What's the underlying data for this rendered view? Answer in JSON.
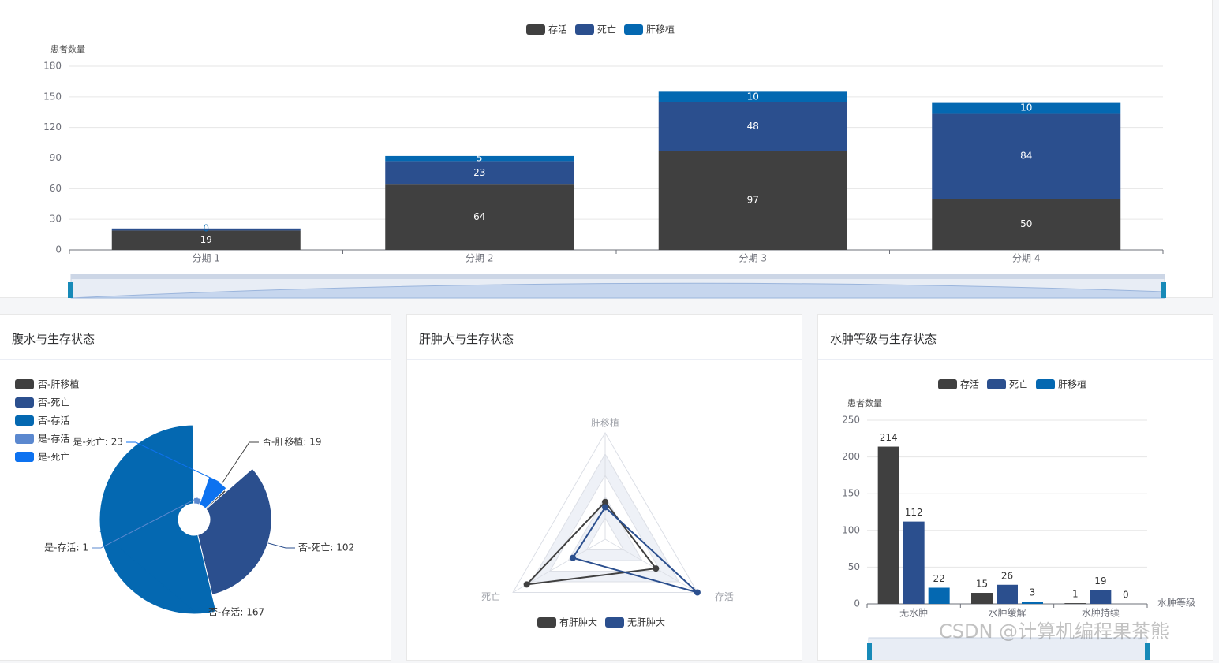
{
  "colors": {
    "survive": "#404040",
    "death": "#2b4f8e",
    "transplant": "#0468b1",
    "light_blue": "#5b88cf",
    "bright_blue": "#0d72f0",
    "grid": "#e6e6e6",
    "axis": "#6e7079"
  },
  "stage_chart": {
    "chart_data": {
      "type": "bar",
      "stacked": true,
      "title": "",
      "xlabel": "",
      "ylabel": "患者数量",
      "categories": [
        "分期 1",
        "分期 2",
        "分期 3",
        "分期 4"
      ],
      "yticks": [
        0,
        30,
        60,
        90,
        120,
        150,
        180
      ],
      "ylim": [
        0,
        180
      ],
      "legend_position": "top-center",
      "grid": true,
      "series": [
        {
          "name": "存活",
          "values": [
            19,
            64,
            97,
            50
          ]
        },
        {
          "name": "死亡",
          "values": [
            2,
            23,
            48,
            84
          ]
        },
        {
          "name": "肝移植",
          "values": [
            0,
            5,
            10,
            10
          ]
        }
      ],
      "data_labels": [
        [
          "19",
          "64",
          "97",
          "50"
        ],
        [
          "",
          "23",
          "48",
          "84"
        ],
        [
          "0",
          "5",
          "10",
          "10"
        ]
      ]
    }
  },
  "ascites_chart": {
    "title": "腹水与生存状态",
    "chart_data": {
      "type": "pie",
      "rose": true,
      "title": "",
      "legend_position": "top-left",
      "slices": [
        {
          "name": "否-肝移植",
          "value": 19,
          "label": "否-肝移植: 19"
        },
        {
          "name": "否-死亡",
          "value": 102,
          "label": "否-死亡: 102"
        },
        {
          "name": "否-存活",
          "value": 167,
          "label": "否-存活: 167"
        },
        {
          "name": "是-存活",
          "value": 1,
          "label": "是-存活: 1"
        },
        {
          "name": "是-死亡",
          "value": 23,
          "label": "是-死亡: 23"
        }
      ]
    }
  },
  "hepato_chart": {
    "title": "肝肿大与生存状态",
    "chart_data": {
      "type": "radar",
      "title": "",
      "legend_position": "bottom-center",
      "indicators": [
        "肝移植",
        "存活",
        "死亡"
      ],
      "series": [
        {
          "name": "有肝肿大",
          "values": [
            0.35,
            0.55,
            0.85
          ]
        },
        {
          "name": "无肝肿大",
          "values": [
            0.3,
            1.0,
            0.35
          ]
        }
      ]
    }
  },
  "edema_chart": {
    "title": "水肿等级与生存状态",
    "chart_data": {
      "type": "bar",
      "title": "",
      "xlabel": "水肿等级",
      "ylabel": "患者数量",
      "categories": [
        "无水肿",
        "水肿缓解",
        "水肿持续"
      ],
      "yticks": [
        0,
        50,
        100,
        150,
        200,
        250
      ],
      "ylim": [
        0,
        250
      ],
      "legend_position": "top-center",
      "grid": true,
      "series": [
        {
          "name": "存活",
          "values": [
            214,
            15,
            1
          ]
        },
        {
          "name": "死亡",
          "values": [
            112,
            26,
            19
          ]
        },
        {
          "name": "肝移植",
          "values": [
            22,
            3,
            0
          ]
        }
      ]
    }
  },
  "watermark": "CSDN @计算机编程果茶熊"
}
